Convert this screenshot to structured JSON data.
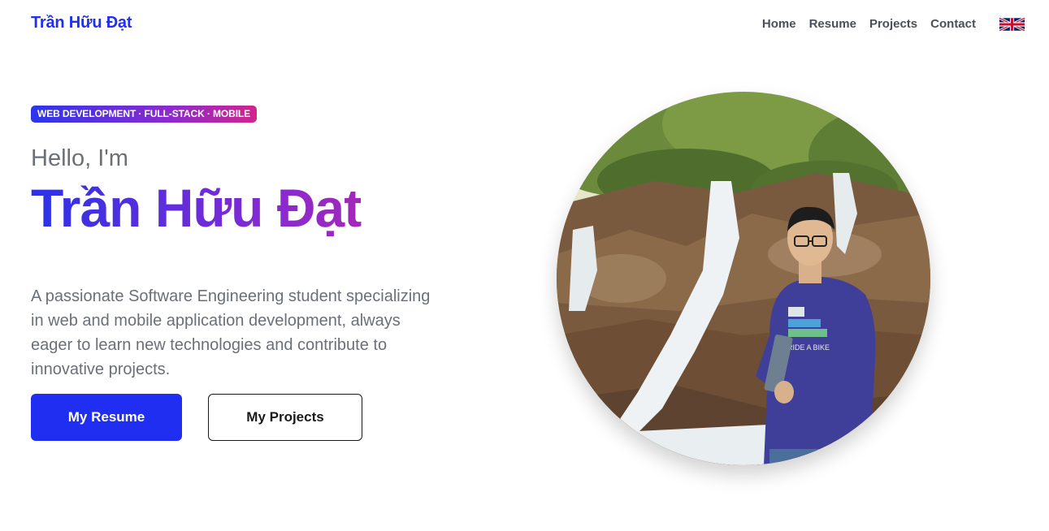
{
  "nav": {
    "brand": "Trần Hữu Đạt",
    "items": [
      {
        "label": "Home"
      },
      {
        "label": "Resume"
      },
      {
        "label": "Projects"
      },
      {
        "label": "Contact"
      }
    ],
    "language_flag": "uk-flag-icon"
  },
  "hero": {
    "badge": "WEB DEVELOPMENT · FULL-STACK · MOBILE",
    "greeting": "Hello, I'm",
    "name": "Trần Hữu Đạt",
    "description": "A passionate Software Engineering student specializing in web and mobile application development, always eager to learn new technologies and contribute to innovative projects.",
    "primary_button": "My Resume",
    "secondary_button": "My Projects",
    "photo_shirt_text": "RIDE A BIKE"
  },
  "colors": {
    "brand_blue": "#2130f0",
    "gradient_start": "#2b32e8",
    "gradient_mid": "#8a2acf",
    "gradient_end": "#c92592"
  }
}
